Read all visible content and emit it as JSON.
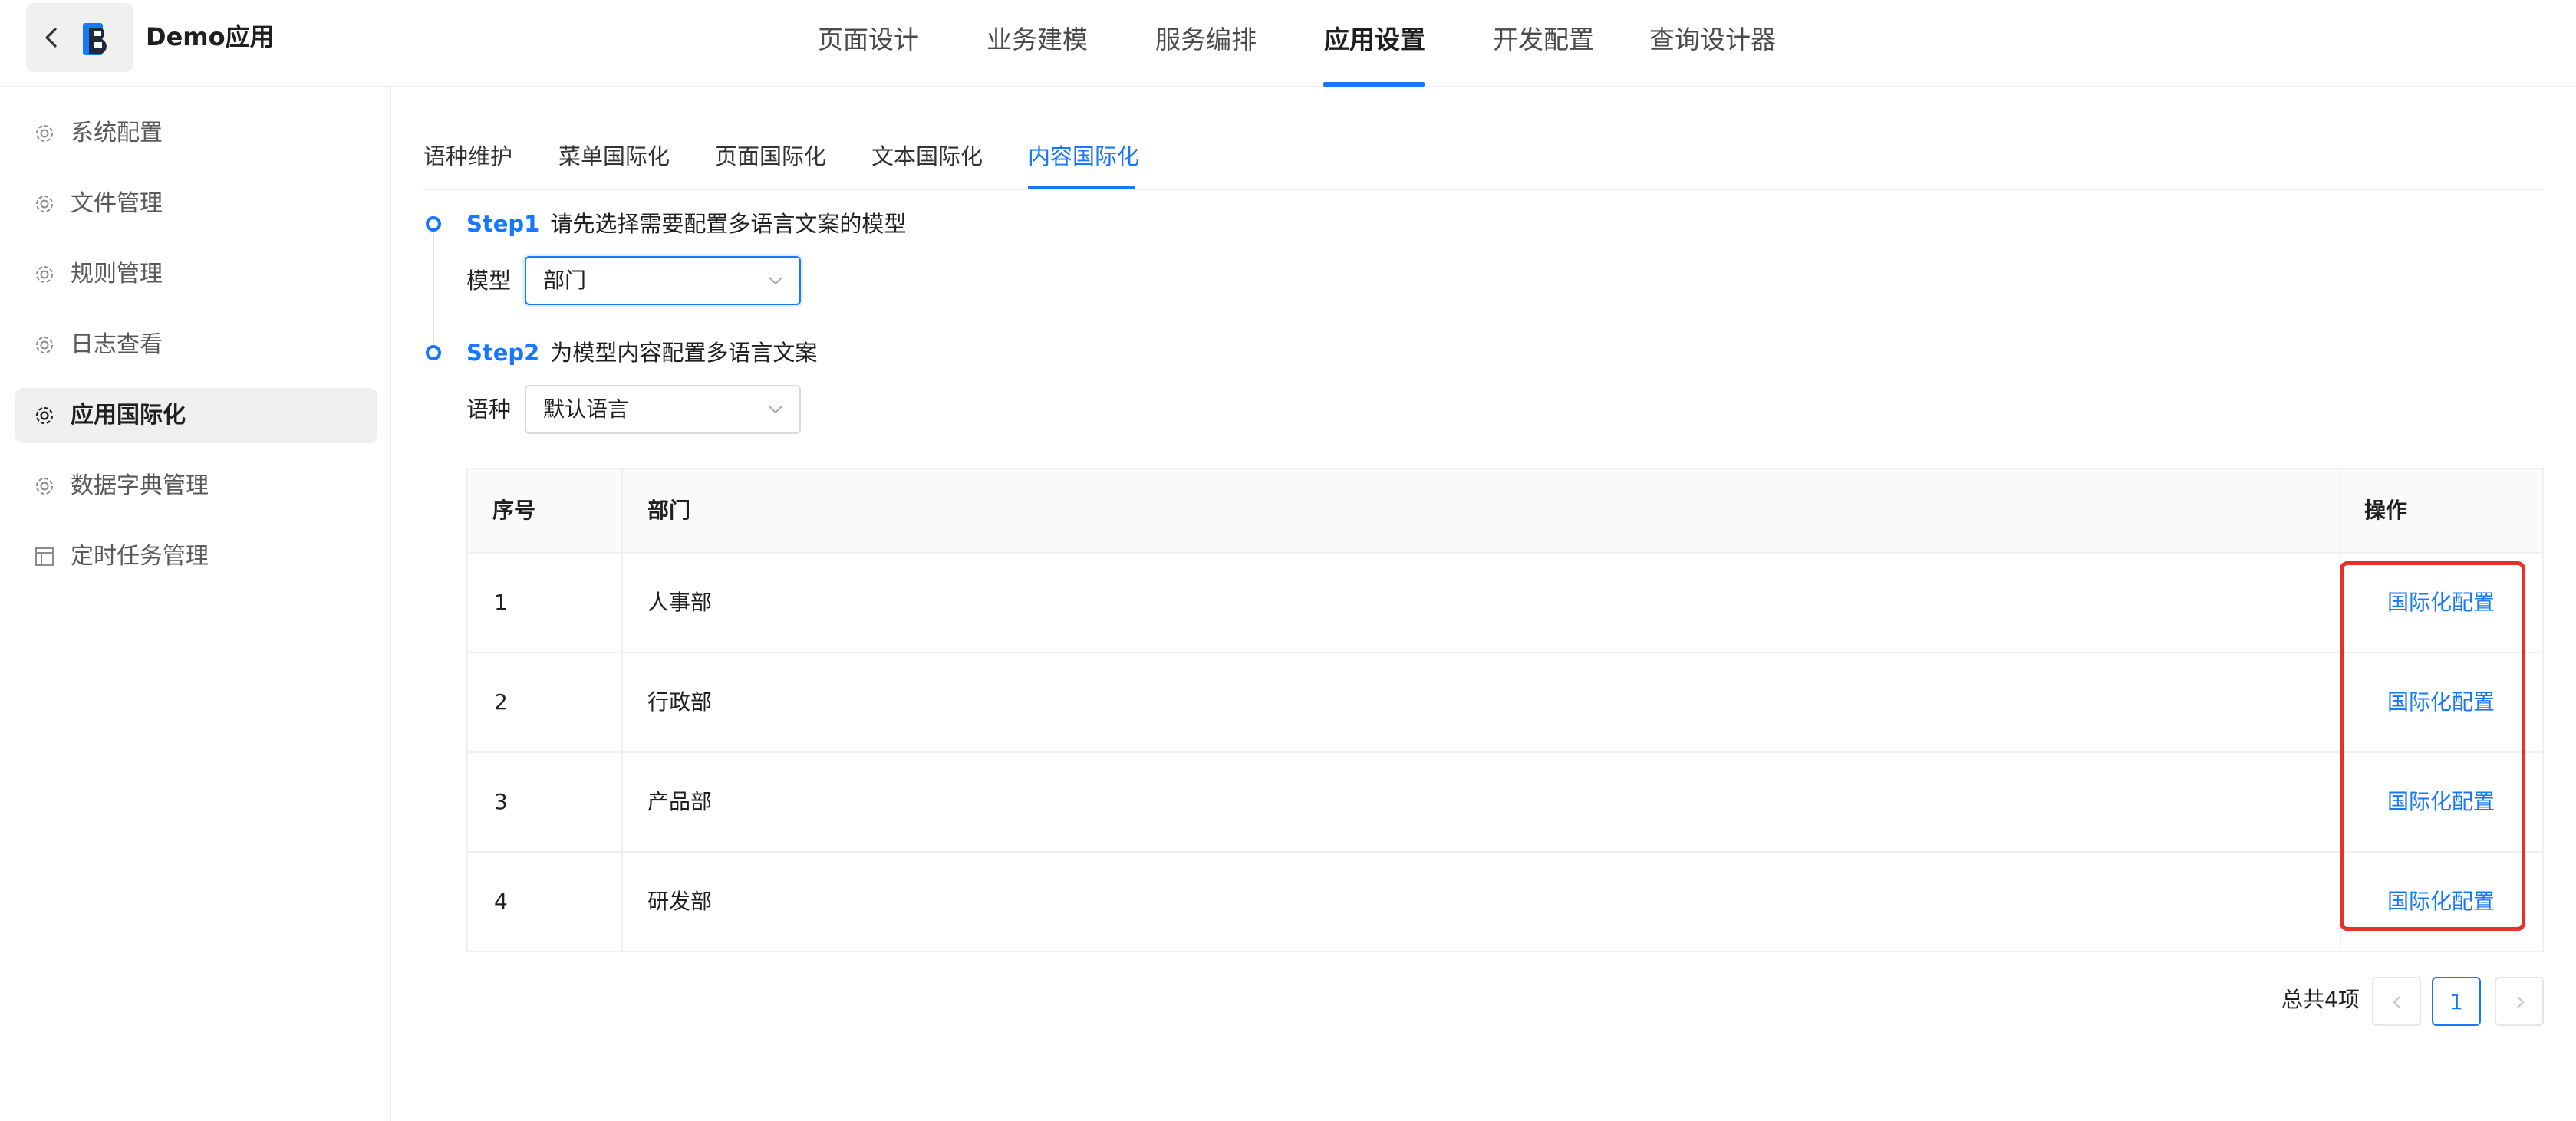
{
  "header": {
    "app_name": "Demo应用",
    "nav": [
      {
        "label": "页面设计"
      },
      {
        "label": "业务建模"
      },
      {
        "label": "服务编排"
      },
      {
        "label": "应用设置",
        "active": true
      },
      {
        "label": "开发配置"
      },
      {
        "label": "查询设计器"
      }
    ]
  },
  "sidebar": {
    "items": [
      {
        "label": "系统配置",
        "icon": "gear-icon"
      },
      {
        "label": "文件管理",
        "icon": "gear-icon"
      },
      {
        "label": "规则管理",
        "icon": "gear-icon"
      },
      {
        "label": "日志查看",
        "icon": "gear-icon"
      },
      {
        "label": "应用国际化",
        "icon": "gear-icon",
        "active": true
      },
      {
        "label": "数据字典管理",
        "icon": "gear-icon"
      },
      {
        "label": "定时任务管理",
        "icon": "layout-icon"
      }
    ]
  },
  "tabs": [
    {
      "label": "语种维护"
    },
    {
      "label": "菜单国际化"
    },
    {
      "label": "页面国际化"
    },
    {
      "label": "文本国际化"
    },
    {
      "label": "内容国际化",
      "active": true
    }
  ],
  "steps": {
    "step1": {
      "num": "Step1",
      "desc": "请先选择需要配置多语言文案的模型",
      "field_label": "模型",
      "value": "部门"
    },
    "step2": {
      "num": "Step2",
      "desc": "为模型内容配置多语言文案",
      "field_label": "语种",
      "value": "默认语言"
    }
  },
  "table": {
    "headers": {
      "index": "序号",
      "name": "部门",
      "action": "操作"
    },
    "rows": [
      {
        "index": "1",
        "name": "人事部",
        "action": "国际化配置"
      },
      {
        "index": "2",
        "name": "行政部",
        "action": "国际化配置"
      },
      {
        "index": "3",
        "name": "产品部",
        "action": "国际化配置"
      },
      {
        "index": "4",
        "name": "研发部",
        "action": "国际化配置"
      }
    ]
  },
  "pagination": {
    "total_text": "总共4项",
    "current_page": "1"
  },
  "colors": {
    "accent": "#1677ff",
    "highlight": "#e5312a"
  }
}
